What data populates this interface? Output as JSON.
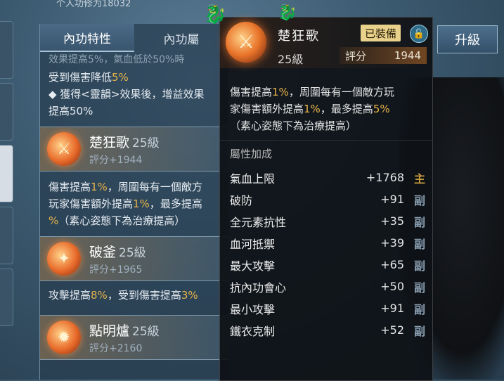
{
  "header": {
    "partial_text": "个人功修为18032"
  },
  "tabs": [
    {
      "label": "內功特性",
      "active": true
    },
    {
      "label": "內功屬",
      "active": false
    }
  ],
  "upgrade_label": "升級",
  "list": {
    "top_desc_line0": "效果提高5%，氣血低於50%時",
    "top_desc_line1_a": "受到傷害降低",
    "top_desc_line1_b": "5%",
    "top_desc_line2": "◆ 獲得<靈韻>效果後，增益效果",
    "top_desc_line3": "提高50%",
    "skills": [
      {
        "name": "楚狂歌",
        "level": "25級",
        "score": "評分+1944",
        "desc_a": "傷害提高",
        "desc_b": "1%",
        "desc_c": "，周圍每有一個敵方",
        "desc_d": "玩家傷害額外提高",
        "desc_e": "1%",
        "desc_f": "，最多提高",
        "desc_g": "%",
        "desc_h": "（素心姿態下為治療提高）"
      },
      {
        "name": "破釜",
        "level": "25級",
        "score": "評分+1965",
        "desc_a": "攻擊提高",
        "desc_b": "8%",
        "desc_c": "，受到傷害提高",
        "desc_d": "3%"
      },
      {
        "name": "點明爐",
        "level": "25級",
        "score": "評分+2160"
      }
    ]
  },
  "tooltip": {
    "name": "楚狂歌",
    "badge": "已裝備",
    "level": "25級",
    "score_label": "評分",
    "score_value": "1944",
    "desc": [
      {
        "t": "傷害提高",
        "h": false
      },
      {
        "t": "1%",
        "h": true
      },
      {
        "t": "，周圍每有一個敵方玩",
        "h": false
      },
      {
        "t": "家傷害額外提高",
        "h": false
      },
      {
        "t": "1%",
        "h": true
      },
      {
        "t": "，最多提高",
        "h": false
      },
      {
        "t": "5%",
        "h": true
      },
      {
        "t": "（素心姿態下為治療提高）",
        "h": false
      }
    ],
    "section_title": "屬性加成",
    "attributes": [
      {
        "name": "氣血上限",
        "value": "+1768",
        "tag": "主"
      },
      {
        "name": "破防",
        "value": "+91",
        "tag": "副"
      },
      {
        "name": "全元素抗性",
        "value": "+35",
        "tag": "副"
      },
      {
        "name": "血河抵禦",
        "value": "+39",
        "tag": "副"
      },
      {
        "name": "最大攻擊",
        "value": "+65",
        "tag": "副"
      },
      {
        "name": "抗內功會心",
        "value": "+50",
        "tag": "副"
      },
      {
        "name": "最小攻擊",
        "value": "+91",
        "tag": "副"
      },
      {
        "name": "鐵衣克制",
        "value": "+52",
        "tag": "副"
      }
    ]
  }
}
